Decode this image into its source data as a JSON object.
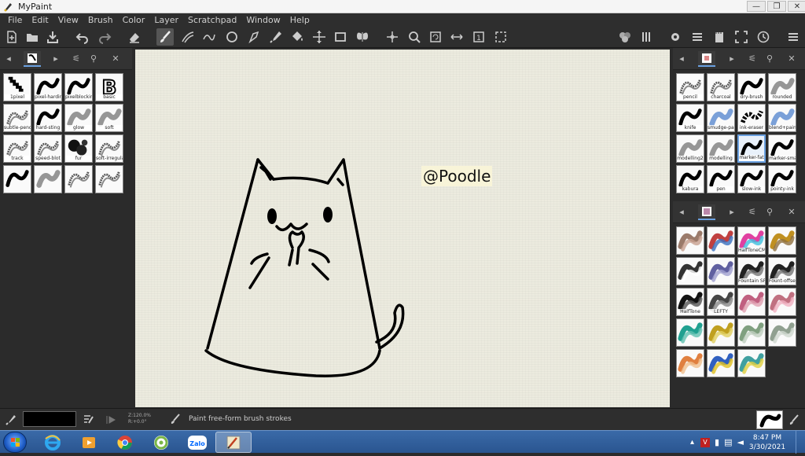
{
  "window": {
    "title": "MyPaint",
    "minimize": "—",
    "maximize": "❐",
    "close": "✕"
  },
  "menu": [
    "File",
    "Edit",
    "View",
    "Brush",
    "Color",
    "Layer",
    "Scratchpad",
    "Window",
    "Help"
  ],
  "left_panel": {
    "brushes": [
      {
        "label": "1pixel",
        "style": "pixel"
      },
      {
        "label": "pixel-hardink",
        "style": "ink"
      },
      {
        "label": "pixelblocking",
        "style": "ink"
      },
      {
        "label": "basic",
        "style": "b"
      },
      {
        "label": "subtle-pencil",
        "style": "pencil"
      },
      {
        "label": "hard-sting",
        "style": "ink"
      },
      {
        "label": "glow",
        "style": "soft"
      },
      {
        "label": "soft",
        "style": "soft"
      },
      {
        "label": "track",
        "style": "pencil"
      },
      {
        "label": "speed-blot",
        "style": "pencil"
      },
      {
        "label": "fur",
        "style": "blot"
      },
      {
        "label": "soft-irregular",
        "style": "pencil"
      },
      {
        "label": "",
        "style": "ink"
      },
      {
        "label": "",
        "style": "soft"
      },
      {
        "label": "",
        "style": "pencil"
      },
      {
        "label": "",
        "style": "pencil"
      }
    ]
  },
  "right_panel_top": {
    "brushes": [
      {
        "label": "pencil",
        "style": "pencil"
      },
      {
        "label": "charcoal",
        "style": "pencil"
      },
      {
        "label": "dry-brush",
        "style": "ink"
      },
      {
        "label": "rounded",
        "style": "soft"
      },
      {
        "label": "knife",
        "style": "ink"
      },
      {
        "label": "smudge-paint",
        "style": "blue"
      },
      {
        "label": "ink-eraser",
        "style": "checker"
      },
      {
        "label": "blend+paint",
        "style": "blue"
      },
      {
        "label": "modelling2",
        "style": "soft"
      },
      {
        "label": "modelling",
        "style": "soft"
      },
      {
        "label": "marker-fat",
        "style": "ink",
        "selected": true
      },
      {
        "label": "marker-small",
        "style": "ink"
      },
      {
        "label": "kabura",
        "style": "ink"
      },
      {
        "label": "pen",
        "style": "ink"
      },
      {
        "label": "slow-ink",
        "style": "ink"
      },
      {
        "label": "pointy-ink",
        "style": "ink"
      }
    ]
  },
  "right_panel_bottom": {
    "brushes": [
      {
        "label": "",
        "color1": "#9a7a6a",
        "color2": "#c8a090"
      },
      {
        "label": "",
        "color1": "#c04040",
        "color2": "#3a70c0"
      },
      {
        "label": "HalfToneCMY",
        "color1": "#e040a0",
        "color2": "#40c0e0"
      },
      {
        "label": "",
        "color1": "#c09020",
        "color2": "#907040"
      },
      {
        "label": "",
        "color1": "#333333",
        "color2": "#ffffff"
      },
      {
        "label": "",
        "color1": "#6060a0",
        "color2": "#a0a0d0"
      },
      {
        "label": "Fountain SF",
        "color1": "#222222",
        "color2": "#777777"
      },
      {
        "label": "Fount-offset",
        "color1": "#222222",
        "color2": "#777777"
      },
      {
        "label": "HalfTone",
        "color1": "#111111",
        "color2": "#555555"
      },
      {
        "label": "LEFTY",
        "color1": "#444444",
        "color2": "#888888"
      },
      {
        "label": "",
        "color1": "#c06080",
        "color2": "#e0a0b0"
      },
      {
        "label": "",
        "color1": "#c07080",
        "color2": "#f0b0c0"
      },
      {
        "label": "",
        "color1": "#20a090",
        "color2": "#60c0b0"
      },
      {
        "label": "",
        "color1": "#c0a020",
        "color2": "#e0d060"
      },
      {
        "label": "",
        "color1": "#80a080",
        "color2": "#c0d0c0"
      },
      {
        "label": "",
        "color1": "#90a090",
        "color2": "#d0d8d0"
      },
      {
        "label": "",
        "color1": "#e08040",
        "color2": "#f0c090"
      },
      {
        "label": "",
        "color1": "#3060c0",
        "color2": "#e0c020"
      },
      {
        "label": "",
        "color1": "#40a0a0",
        "color2": "#e0d040"
      }
    ]
  },
  "canvas": {
    "tag_text": "@Poodle"
  },
  "status": {
    "zoom": "Z:120.0%",
    "rotation": "R:+0.0°",
    "message": "Paint free-form brush strokes",
    "color": "#000000"
  },
  "taskbar": {
    "time": "8:47 PM",
    "date": "3/30/2021",
    "apps": [
      "ie-icon",
      "media-player-icon",
      "chrome-icon",
      "coccoc-icon",
      "zalo-icon",
      "mypaint-icon"
    ],
    "zalo_label": "Zalo"
  }
}
